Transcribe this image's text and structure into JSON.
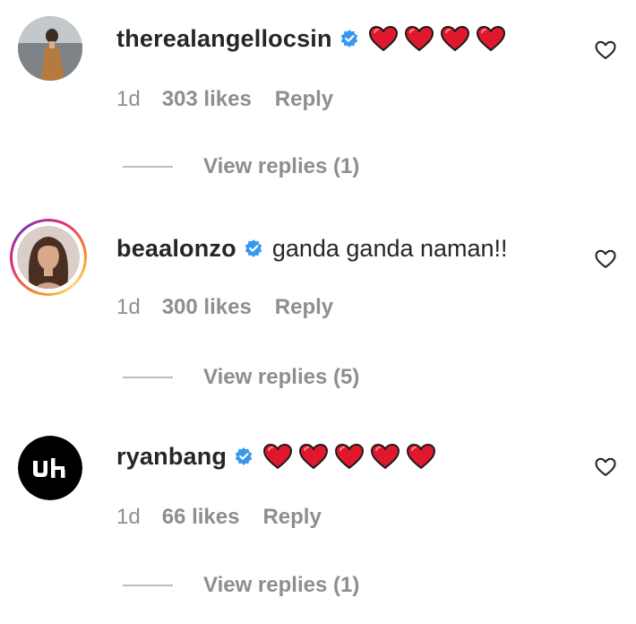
{
  "comments": [
    {
      "username": "therealangellocsin",
      "text": "",
      "heart_count": 4,
      "time": "1d",
      "likes": "303 likes",
      "reply_label": "Reply",
      "view_replies": "View replies (1)"
    },
    {
      "username": "beaalonzo",
      "text": "ganda ganda naman!!",
      "heart_count": 0,
      "time": "1d",
      "likes": "300 likes",
      "reply_label": "Reply",
      "view_replies": "View replies (5)"
    },
    {
      "username": "ryanbang",
      "text": "",
      "heart_count": 5,
      "time": "1d",
      "likes": "66 likes",
      "reply_label": "Reply",
      "view_replies": "View replies (1)"
    }
  ],
  "colors": {
    "verified": "#3897f0",
    "heart_emoji": "#e0182d",
    "meta_text": "#8e8e8e",
    "username": "#262626"
  },
  "icons": {
    "verified": "verified-badge-icon",
    "like": "heart-outline-icon",
    "emoji": "red-heart-emoji"
  }
}
